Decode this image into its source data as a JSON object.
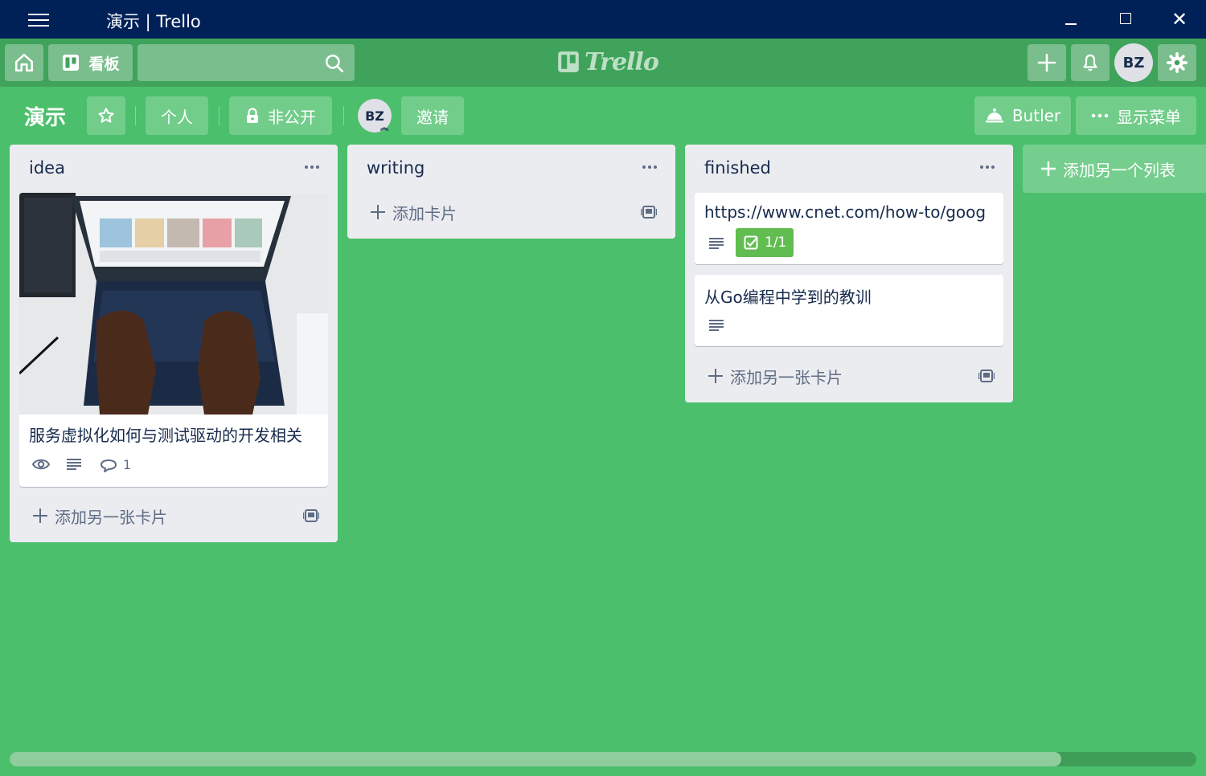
{
  "window": {
    "title": "演示 | Trello",
    "controls": [
      "minimize",
      "maximize",
      "close"
    ]
  },
  "header": {
    "boards_label": "看板",
    "search_placeholder": "",
    "logo_text": "Trello",
    "avatar_initials": "BZ"
  },
  "board": {
    "title": "演示",
    "team_label": "个人",
    "visibility_label": "非公开",
    "member_initials": "BZ",
    "invite_label": "邀请",
    "butler_label": "Butler",
    "show_menu_label": "显示菜单"
  },
  "lists": [
    {
      "title": "idea",
      "cards": [
        {
          "title": "服务虚拟化如何与测试驱动的开发相关",
          "has_cover": true,
          "watching": true,
          "has_description": true,
          "comments": "1"
        }
      ],
      "add_card_label": "添加另一张卡片"
    },
    {
      "title": "writing",
      "cards": [],
      "add_card_label": "添加卡片"
    },
    {
      "title": "finished",
      "cards": [
        {
          "title": "https://www.cnet.com/how-to/goog",
          "has_description": true,
          "checklist": "1/1"
        },
        {
          "title": "从Go编程中学到的教训",
          "has_description": true
        }
      ],
      "add_card_label": "添加另一张卡片"
    }
  ],
  "add_list_label": "添加另一个列表",
  "colors": {
    "board_bg": "#4bbf6b",
    "header_bg": "#3fa35b",
    "titlebar_bg": "#002158",
    "list_bg": "#ebecf0",
    "checklist_complete": "#61bd4f"
  },
  "scrollbar": {
    "position_fraction": 0.0,
    "visible_fraction": 0.886
  }
}
